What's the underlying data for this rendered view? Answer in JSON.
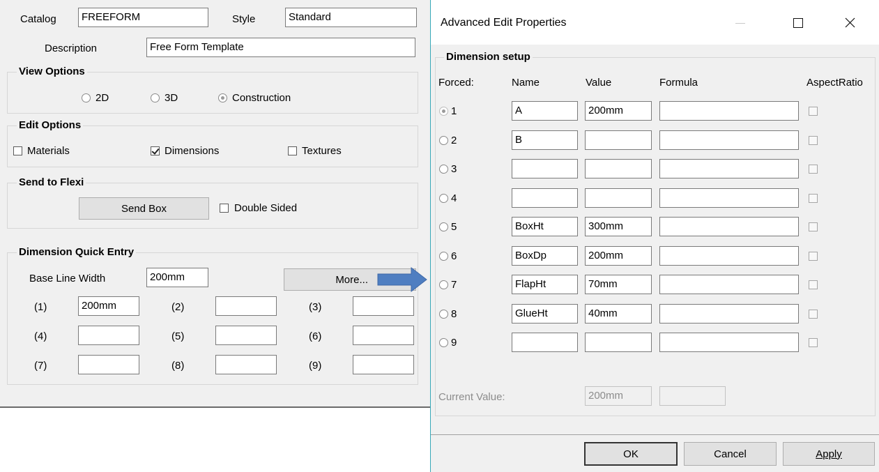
{
  "left": {
    "catalog_label": "Catalog",
    "catalog_value": "FREEFORM",
    "style_label": "Style",
    "style_value": "Standard",
    "description_label": "Description",
    "description_value": "Free Form Template",
    "view_options": {
      "title": "View Options",
      "options": [
        "2D",
        "3D",
        "Construction"
      ],
      "selected": "Construction"
    },
    "edit_options": {
      "title": "Edit Options",
      "materials_label": "Materials",
      "materials_checked": false,
      "dimensions_label": "Dimensions",
      "dimensions_checked": true,
      "textures_label": "Textures",
      "textures_checked": false
    },
    "send_to_flexi": {
      "title": "Send to Flexi",
      "send_box_label": "Send Box",
      "double_sided_label": "Double Sided",
      "double_sided_checked": false
    },
    "quick_entry": {
      "title": "Dimension Quick Entry",
      "base_line_label": "Base Line Width",
      "base_line_value": "200mm",
      "more_label": "More...",
      "fields": [
        {
          "label": "(1)",
          "value": "200mm"
        },
        {
          "label": "(2)",
          "value": ""
        },
        {
          "label": "(3)",
          "value": ""
        },
        {
          "label": "(4)",
          "value": ""
        },
        {
          "label": "(5)",
          "value": ""
        },
        {
          "label": "(6)",
          "value": ""
        },
        {
          "label": "(7)",
          "value": ""
        },
        {
          "label": "(8)",
          "value": ""
        },
        {
          "label": "(9)",
          "value": ""
        }
      ]
    }
  },
  "dialog": {
    "title": "Advanced Edit Properties",
    "group_title": "Dimension setup",
    "headers": {
      "forced": "Forced:",
      "name": "Name",
      "value": "Value",
      "formula": "Formula",
      "aspect": "AspectRatio"
    },
    "rows": [
      {
        "num": "1",
        "name": "A",
        "value": "200mm",
        "formula": "",
        "selected": true
      },
      {
        "num": "2",
        "name": "B",
        "value": "",
        "formula": "",
        "selected": false
      },
      {
        "num": "3",
        "name": "",
        "value": "",
        "formula": "",
        "selected": false
      },
      {
        "num": "4",
        "name": "",
        "value": "",
        "formula": "",
        "selected": false
      },
      {
        "num": "5",
        "name": "BoxHt",
        "value": "300mm",
        "formula": "",
        "selected": false
      },
      {
        "num": "6",
        "name": "BoxDp",
        "value": "200mm",
        "formula": "",
        "selected": false
      },
      {
        "num": "7",
        "name": "FlapHt",
        "value": "70mm",
        "formula": "",
        "selected": false
      },
      {
        "num": "8",
        "name": "GlueHt",
        "value": "40mm",
        "formula": "",
        "selected": false
      },
      {
        "num": "9",
        "name": "",
        "value": "",
        "formula": "",
        "selected": false
      }
    ],
    "current_value_label": "Current Value:",
    "current_value": "200mm",
    "current_value_2": "",
    "ok_label": "OK",
    "cancel_label": "Cancel",
    "apply_label": "Apply"
  },
  "colors": {
    "arrow": "#4f7ec1",
    "dialog_border": "#36a8b8"
  }
}
